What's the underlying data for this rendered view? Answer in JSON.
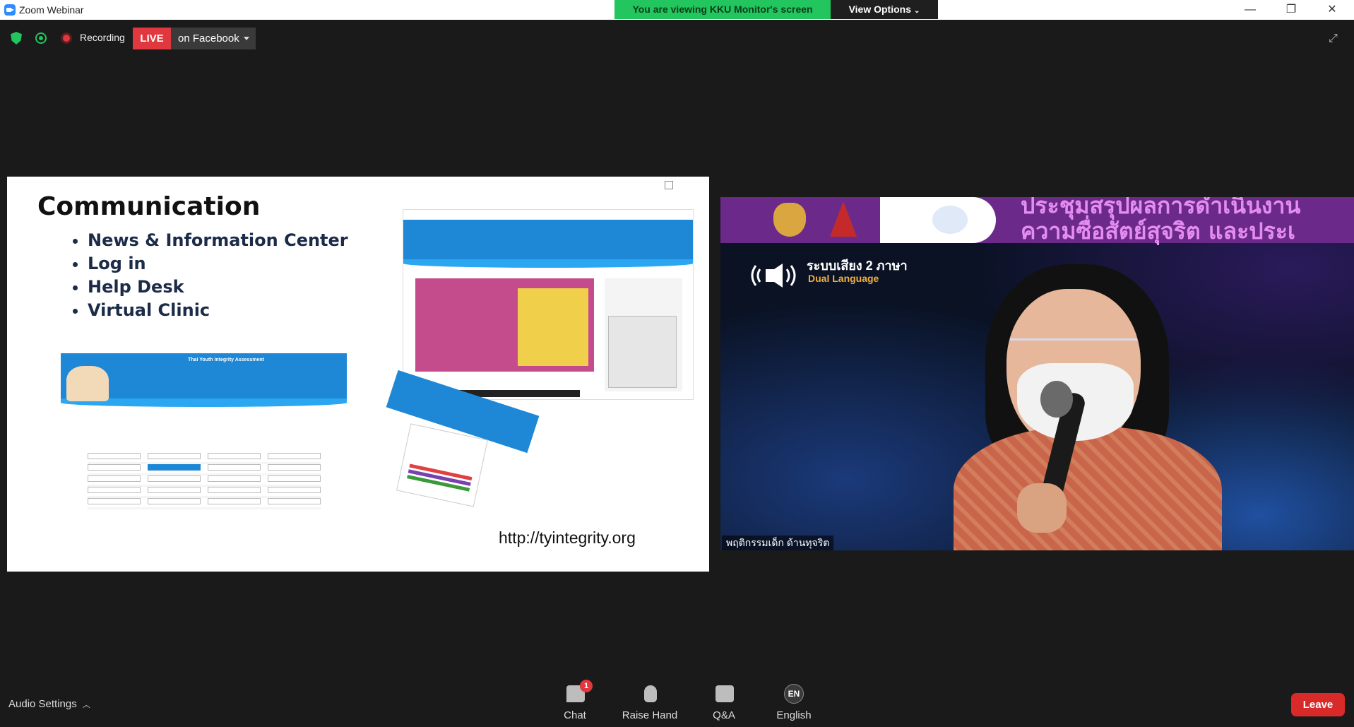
{
  "window": {
    "title": "Zoom Webinar",
    "banner_text": "You are viewing KKU Monitor's screen",
    "view_options_label": "View Options",
    "minimize_glyph": "—",
    "restore_glyph": "❐",
    "close_glyph": "✕"
  },
  "top_toolbar": {
    "recording_label": "Recording",
    "live_label": "LIVE",
    "live_destination": "on Facebook",
    "fullscreen_glyph": "⤢"
  },
  "slide": {
    "title": "Communication",
    "bullets": [
      "News & Information Center",
      "Log in",
      "Help Desk",
      "Virtual Clinic"
    ],
    "url": "http://tyintegrity.org",
    "thumb_heading": "Thai Youth Integrity Assessment"
  },
  "video": {
    "headline_line1": "ประชุมสรุปผลการดำเนินงาน",
    "headline_line2": "ความซื่อสัตย์สุจริต และประเ",
    "audio_thai": "ระบบเสียง 2 ภาษา",
    "audio_english": "Dual Language",
    "participant_name": "พฤติกรรมเด็ก ด้านทุจริต"
  },
  "bottom_toolbar": {
    "audio_settings_label": "Audio Settings",
    "chat_label": "Chat",
    "chat_badge": "1",
    "raise_hand_label": "Raise Hand",
    "qa_label": "Q&A",
    "language_code": "EN",
    "language_label": "English",
    "leave_label": "Leave"
  },
  "colors": {
    "banner_green": "#22c55e",
    "live_red": "#e0383e",
    "leave_red": "#d92a2a",
    "background": "#1a1a1a"
  }
}
